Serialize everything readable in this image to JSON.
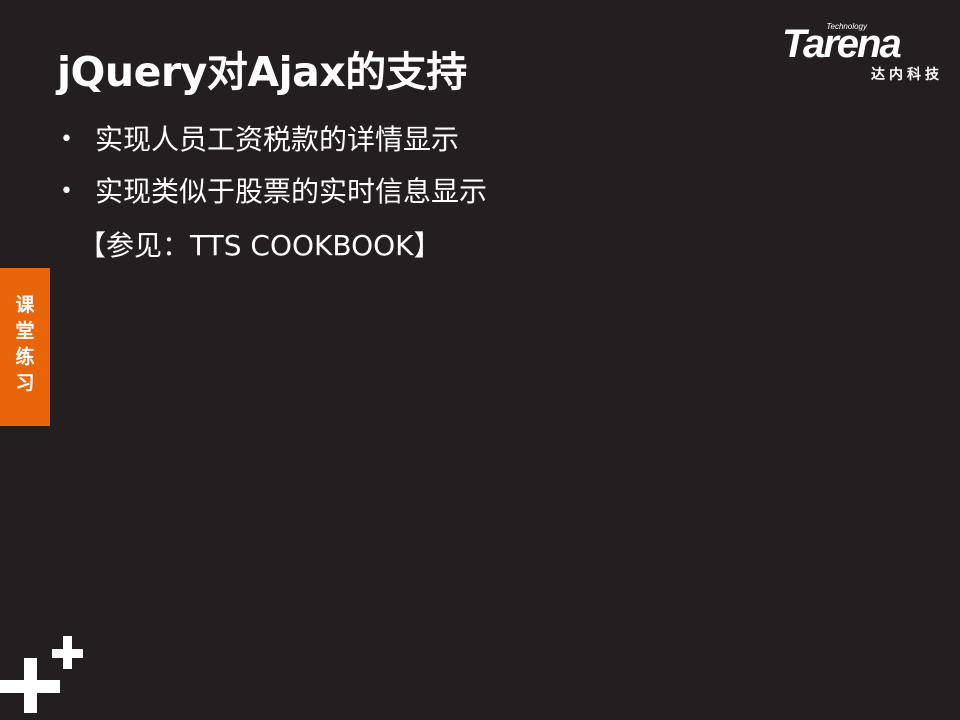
{
  "slide": {
    "title": "jQuery对Ajax的支持",
    "bullets": [
      "实现人员工资税款的详情显示",
      "实现类似于股票的实时信息显示"
    ],
    "bullet_glyph": "•",
    "reference": "【参见：TTS COOKBOOK】"
  },
  "logo": {
    "tag": "Technology",
    "name": "Tarena",
    "cn_name": "达内科技"
  },
  "side_tab": {
    "label": "课堂练习",
    "color": "#e8650a"
  },
  "colors": {
    "background": "#231f20",
    "text": "#ffffff",
    "accent": "#e8650a"
  },
  "decor": {
    "corner_icon": "plus-plus-icon"
  }
}
